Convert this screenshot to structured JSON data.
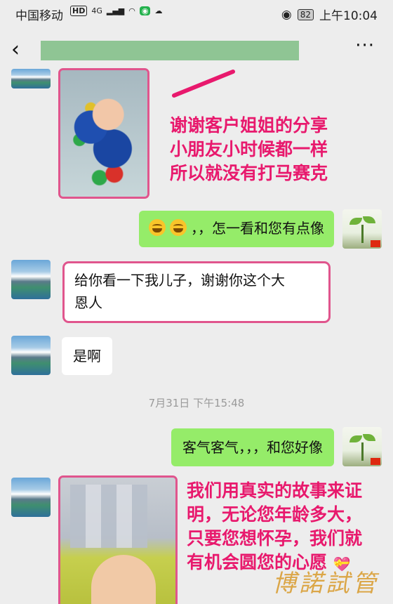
{
  "status_bar": {
    "carrier": "中国移动",
    "hd": "HD",
    "net": "4G",
    "battery": "82",
    "time": "上午10:04"
  },
  "header": {
    "back_icon": "chevron-left-icon",
    "more_icon": "more-icon",
    "more_label": "···"
  },
  "messages": [
    {
      "side": "left",
      "type": "image",
      "desc_icon": "baby-in-pool-photo"
    },
    {
      "side": "right",
      "type": "text",
      "emoji": 2,
      "text": "，，怎一看和您有点像"
    },
    {
      "side": "left",
      "type": "text",
      "text_line1": "给你看一下我儿子，谢谢你这个大",
      "text_line2": "恩人"
    },
    {
      "side": "left",
      "type": "text",
      "text": "是啊"
    },
    {
      "side": "right",
      "type": "text",
      "text": "客气客气，，，和您好像"
    },
    {
      "side": "left",
      "type": "image",
      "desc_icon": "baby-photo-mosaic"
    }
  ],
  "timestamp": "7月31日 下午15:48",
  "annotations": {
    "top": [
      "谢谢客户姐姐的分享",
      "小朋友小时候都一样",
      "所以就没有打马赛克"
    ],
    "bottom": [
      "我们用真实的故事来证",
      "明，无论您年龄多大，",
      "只要您想怀孕，我们就",
      "有机会圆您的心愿"
    ]
  },
  "watermark": "博諾試管",
  "colors": {
    "pink": "#e0558d",
    "annot_text": "#e8196d",
    "bubble_green": "#95ec69"
  }
}
